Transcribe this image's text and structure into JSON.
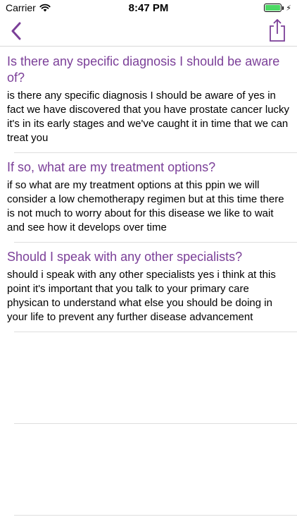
{
  "status_bar": {
    "carrier": "Carrier",
    "time": "8:47 PM",
    "battery_level": 1.0,
    "battery_color": "#4cd964"
  },
  "nav": {
    "back_icon": "chevron-left-icon",
    "share_icon": "share-icon",
    "accent_color": "#7b3f98"
  },
  "qa_items": [
    {
      "question": "Is there any specific diagnosis I should be aware of?",
      "answer": "is there any specific diagnosis I should be aware of yes in fact we have discovered that you have prostate cancer lucky it's in its early stages and we've caught it in time that we can treat you"
    },
    {
      "question": "If so, what are my treatment options?",
      "answer": "if so what are my treatment options at this ppin we will consider a low chemotherapy regimen but at this time there is not much to worry about for this disease we like to wait and see how it develops over time"
    },
    {
      "question": "Should I speak with any other specialists?",
      "answer": "should i speak with any other specialists yes i think at this point it's important that you talk to your primary care physican to understand what else you should be doing in your life to prevent any further disease advancement"
    }
  ]
}
